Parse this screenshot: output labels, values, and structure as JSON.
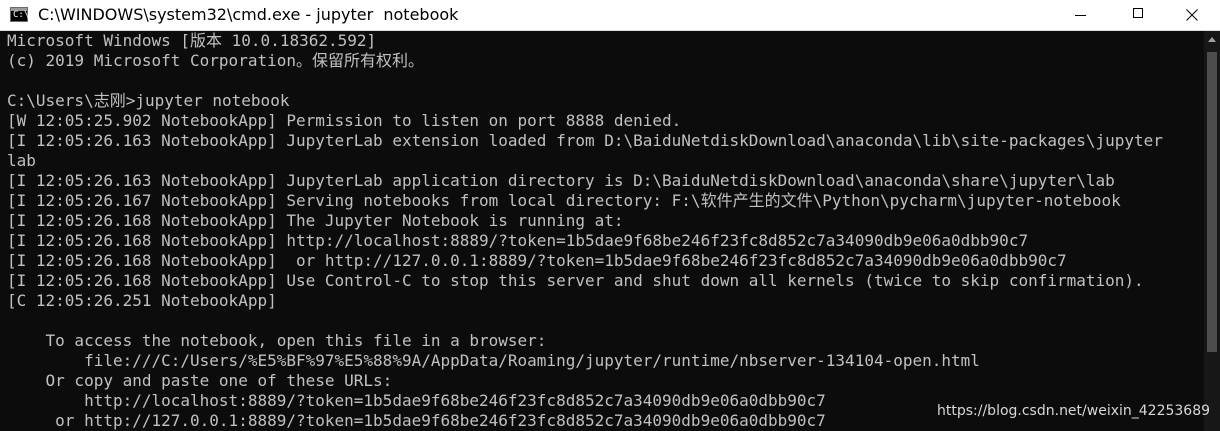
{
  "window": {
    "title": "C:\\WINDOWS\\system32\\cmd.exe - jupyter  notebook",
    "icon_text": "C:\\"
  },
  "console": {
    "lines": [
      "Microsoft Windows [版本 10.0.18362.592]",
      "(c) 2019 Microsoft Corporation。保留所有权利。",
      "",
      "C:\\Users\\志刚>jupyter notebook",
      "[W 12:05:25.902 NotebookApp] Permission to listen on port 8888 denied.",
      "[I 12:05:26.163 NotebookApp] JupyterLab extension loaded from D:\\BaiduNetdiskDownload\\anaconda\\lib\\site-packages\\jupyter",
      "lab",
      "[I 12:05:26.163 NotebookApp] JupyterLab application directory is D:\\BaiduNetdiskDownload\\anaconda\\share\\jupyter\\lab",
      "[I 12:05:26.167 NotebookApp] Serving notebooks from local directory: F:\\软件产生的文件\\Python\\pycharm\\jupyter-notebook",
      "[I 12:05:26.168 NotebookApp] The Jupyter Notebook is running at:",
      "[I 12:05:26.168 NotebookApp] http://localhost:8889/?token=1b5dae9f68be246f23fc8d852c7a34090db9e06a0dbb90c7",
      "[I 12:05:26.168 NotebookApp]  or http://127.0.0.1:8889/?token=1b5dae9f68be246f23fc8d852c7a34090db9e06a0dbb90c7",
      "[I 12:05:26.168 NotebookApp] Use Control-C to stop this server and shut down all kernels (twice to skip confirmation).",
      "[C 12:05:26.251 NotebookApp]",
      "",
      "    To access the notebook, open this file in a browser:",
      "        file:///C:/Users/%E5%BF%97%E5%88%9A/AppData/Roaming/jupyter/runtime/nbserver-134104-open.html",
      "    Or copy and paste one of these URLs:",
      "        http://localhost:8889/?token=1b5dae9f68be246f23fc8d852c7a34090db9e06a0dbb90c7",
      "     or http://127.0.0.1:8889/?token=1b5dae9f68be246f23fc8d852c7a34090db9e06a0dbb90c7"
    ]
  },
  "watermark": "https://blog.csdn.net/weixin_42253689"
}
